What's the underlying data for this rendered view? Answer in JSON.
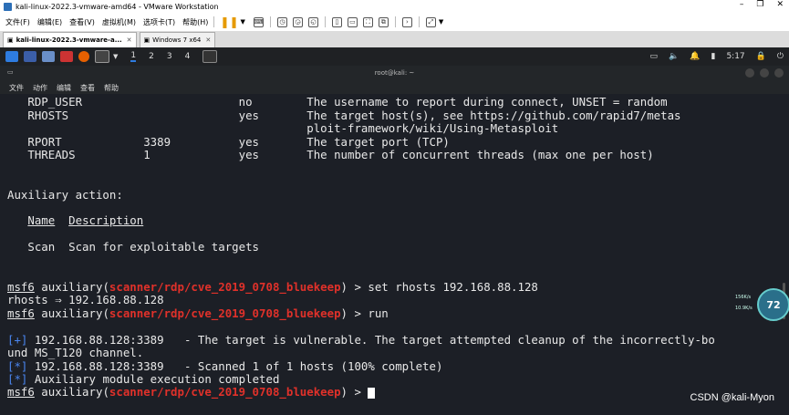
{
  "window": {
    "title": "kali-linux-2022.3-vmware-amd64 - VMware Workstation"
  },
  "menubar": {
    "items": [
      "文件(F)",
      "编辑(E)",
      "查看(V)",
      "虚拟机(M)",
      "选项卡(T)",
      "帮助(H)"
    ]
  },
  "tabs": [
    {
      "label": "kali-linux-2022.3-vmware-a..."
    },
    {
      "label": "Windows 7 x64"
    }
  ],
  "panel": {
    "workspaces": [
      "1",
      "2",
      "3",
      "4"
    ],
    "time": "5:17"
  },
  "terminal": {
    "title": "root@kali: ~",
    "menu": [
      "文件",
      "动作",
      "编辑",
      "查看",
      "帮助"
    ],
    "lines": {
      "l1": "   RDP_USER                       no        The username to report during connect, UNSET = random",
      "l2": "   RHOSTS                         yes       The target host(s), see https://github.com/rapid7/metas",
      "l3": "                                            ploit-framework/wiki/Using-Metasploit",
      "l4": "   RPORT            3389          yes       The target port (TCP)",
      "l5": "   THREADS          1             yes       The number of concurrent threads (max one per host)",
      "l6": "Auxiliary action:",
      "l7_name": "Name",
      "l7_desc": "Description",
      "l8": "   Scan  Scan for exploitable targets",
      "prompt_prefix": "msf6",
      "prompt_mid": " auxiliary(",
      "module": "scanner/rdp/cve_2019_0708_bluekeep",
      "prompt_end": ") > ",
      "cmd1": "set rhosts 192.168.88.128",
      "rhosts_echo": "rhosts ⇒ 192.168.88.128",
      "cmd2": "run",
      "plus": "[+]",
      "r1": " 192.168.88.128:3389   - The target is vulnerable. The target attempted cleanup of the incorrectly-bo",
      "r1b": "und MS_T120 channel.",
      "star": "[*]",
      "r2": " 192.168.88.128:3389   - Scanned 1 of 1 hosts (100% complete)",
      "r3": " Auxiliary module execution completed"
    }
  },
  "overlay": {
    "gauge": "72",
    "net_up": "156K/s",
    "net_down": "10.9K/s"
  },
  "watermark": "CSDN @kali-Myon",
  "colors": {
    "terminal_bg": "#1c1f26",
    "prompt_blue": "#4a86f0",
    "module_red": "#e0312a"
  }
}
